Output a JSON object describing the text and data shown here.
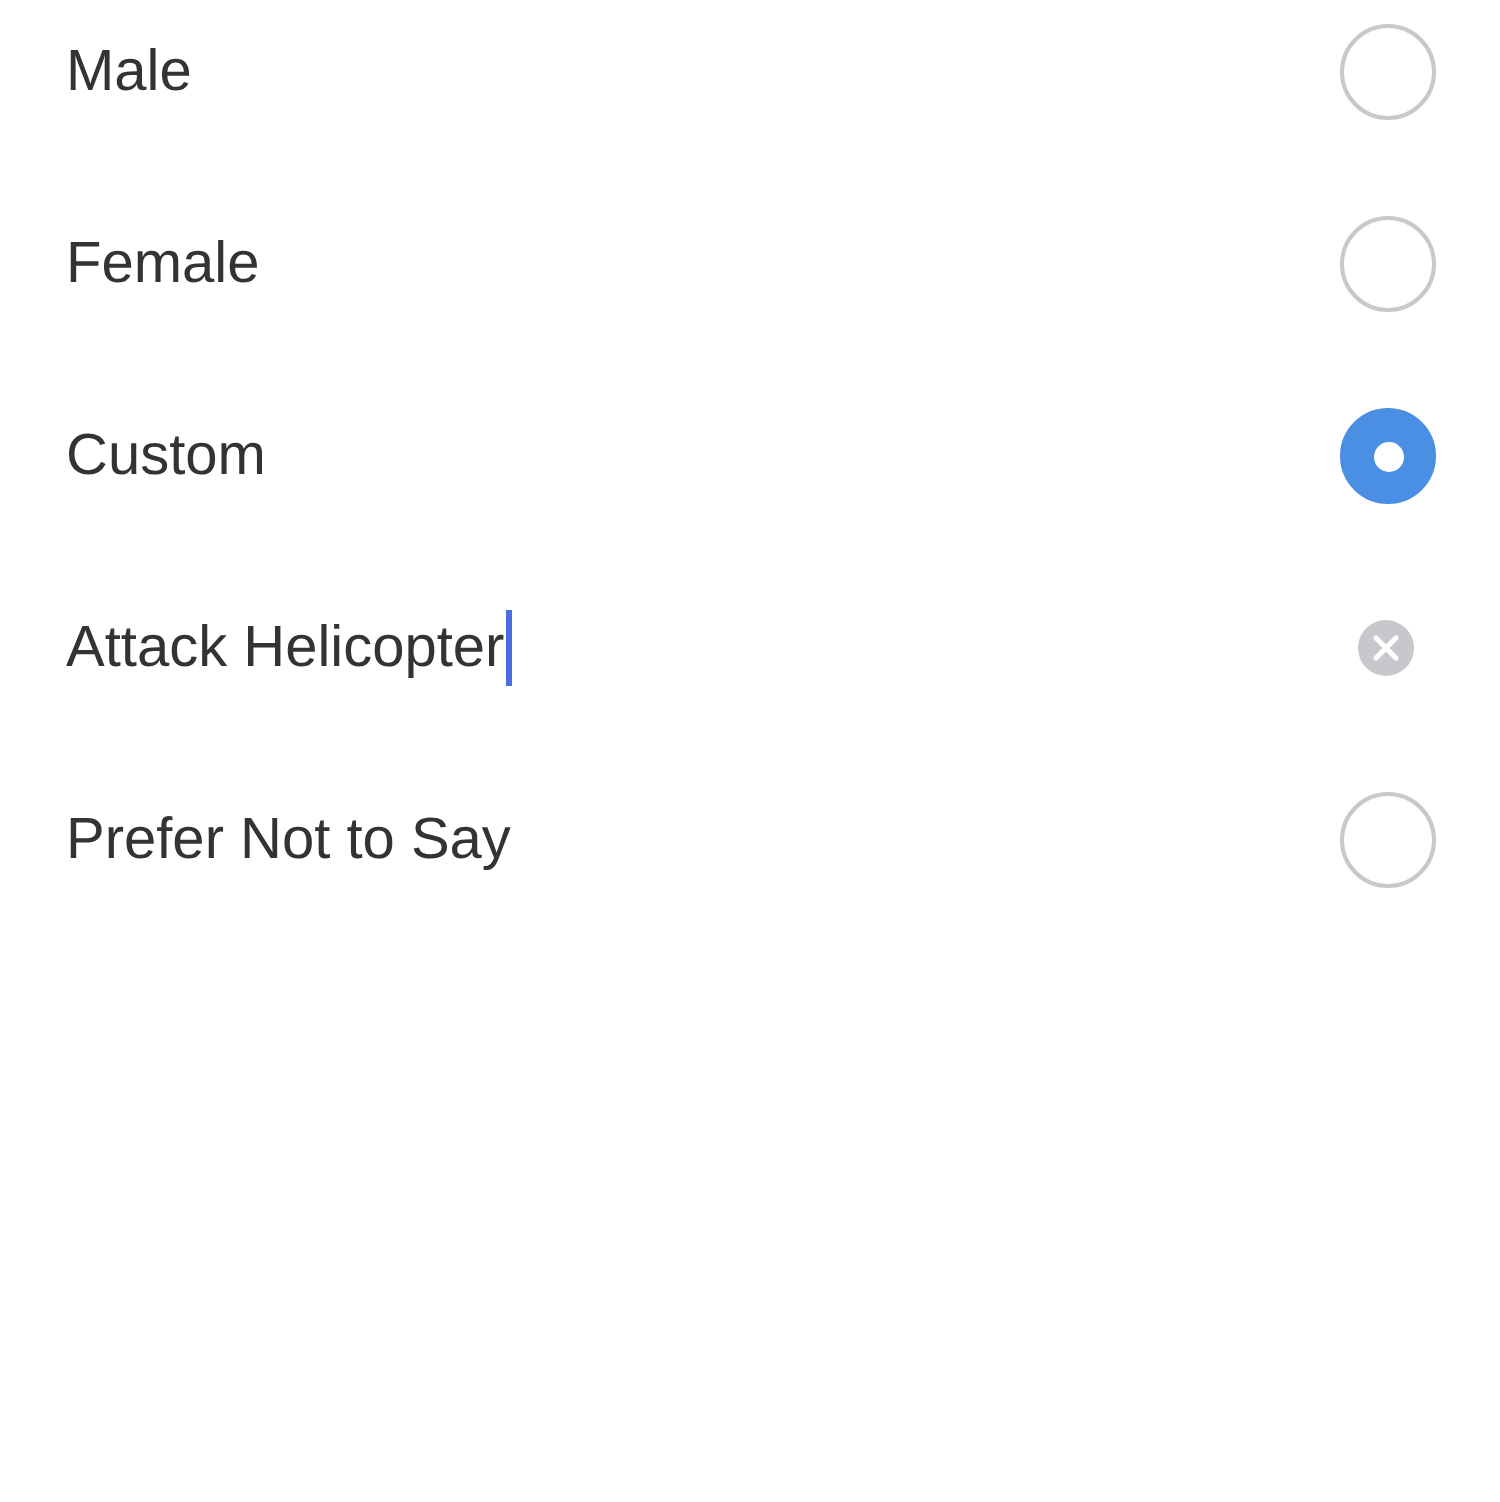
{
  "options": [
    {
      "kind": "radio",
      "label": "Male",
      "selected": false
    },
    {
      "kind": "radio",
      "label": "Female",
      "selected": false
    },
    {
      "kind": "radio",
      "label": "Custom",
      "selected": true
    },
    {
      "kind": "field",
      "value": "Attack Helicopter",
      "focused": true
    },
    {
      "kind": "radio",
      "label": "Prefer Not to Say",
      "selected": false
    }
  ]
}
